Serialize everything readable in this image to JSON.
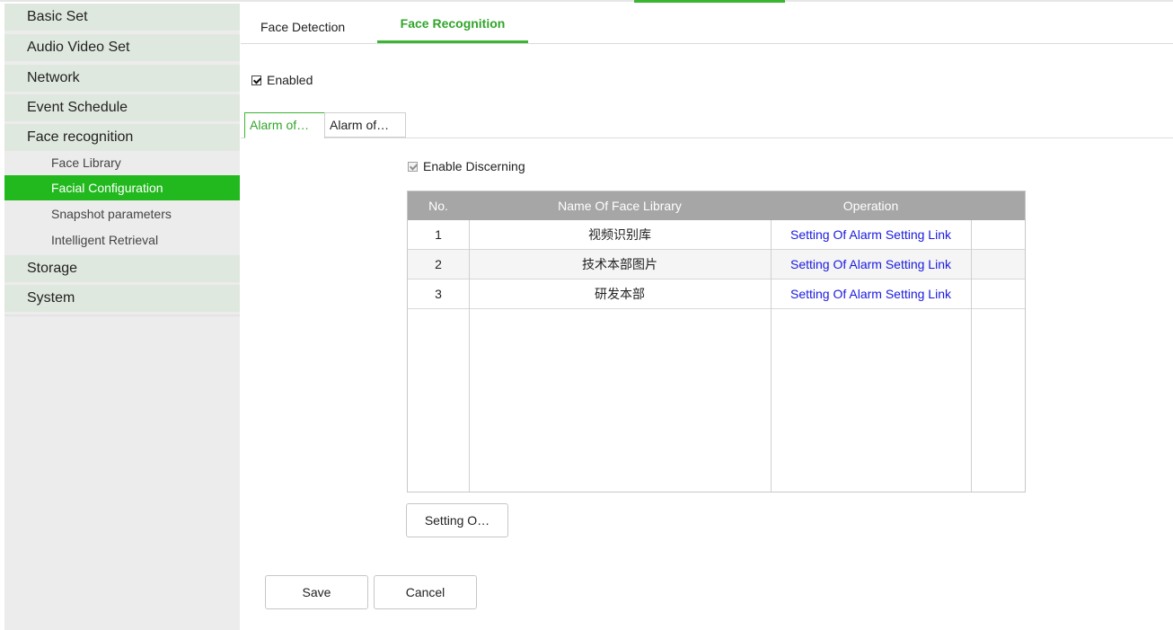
{
  "sidebar": {
    "items": [
      {
        "label": "Basic Set"
      },
      {
        "label": "Audio Video Set"
      },
      {
        "label": "Network"
      },
      {
        "label": "Event Schedule"
      },
      {
        "label": "Face recognition"
      },
      {
        "label": "Storage"
      },
      {
        "label": "System"
      }
    ],
    "sub_items": [
      {
        "label": "Face Library"
      },
      {
        "label": "Facial Configuration"
      },
      {
        "label": "Snapshot parameters"
      },
      {
        "label": "Intelligent Retrieval"
      }
    ]
  },
  "tabs": [
    {
      "label": "Face Detection"
    },
    {
      "label": "Face Recognition"
    }
  ],
  "enabled": {
    "label": "Enabled",
    "checked": true
  },
  "sub_tabs": [
    {
      "label": "Alarm of…"
    },
    {
      "label": "Alarm of…"
    }
  ],
  "enable_discerning": {
    "label": "Enable Discerning",
    "checked": true,
    "disabled": true
  },
  "table": {
    "headers": [
      "No.",
      "Name Of Face Library",
      "Operation",
      ""
    ],
    "rows": [
      {
        "no": "1",
        "name": "视频识别库",
        "operation": "Setting Of Alarm Setting Link"
      },
      {
        "no": "2",
        "name": "技术本部图片",
        "operation": "Setting Of Alarm Setting Link"
      },
      {
        "no": "3",
        "name": "研发本部",
        "operation": "Setting Of Alarm Setting Link"
      }
    ]
  },
  "buttons": {
    "setting": "Setting O…",
    "save": "Save",
    "cancel": "Cancel"
  },
  "colors": {
    "accent": "#3cb532",
    "active_nav": "#22b91e",
    "link": "#1a1ae0",
    "table_header": "#a6a6a6"
  }
}
